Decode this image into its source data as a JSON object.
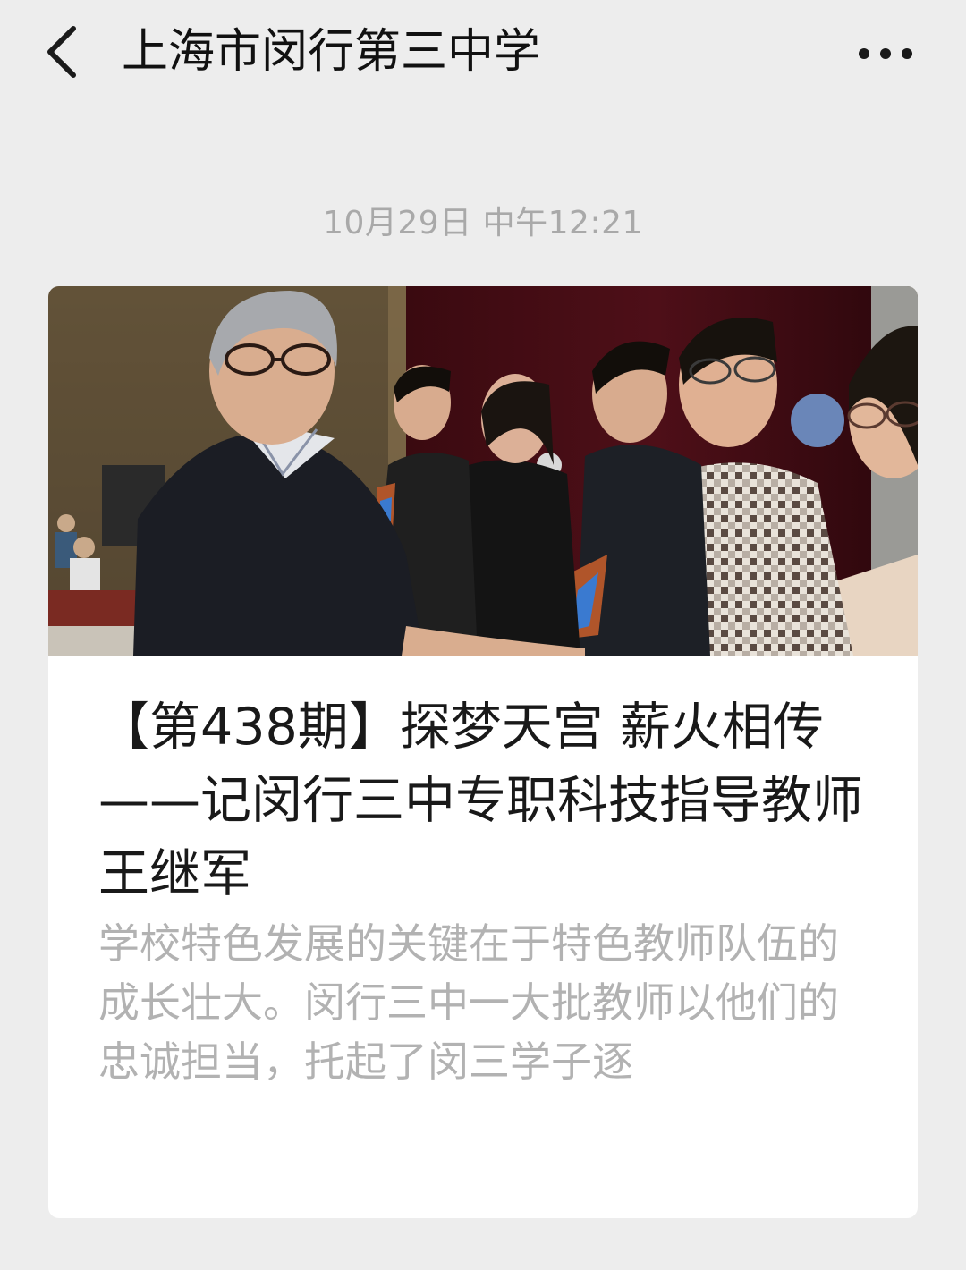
{
  "nav": {
    "back_icon": "chevron-left-icon",
    "title": "上海市闵行第三中学",
    "more_icon": "more-horizontal-icon"
  },
  "message": {
    "timestamp": "10月29日 中午12:21"
  },
  "article": {
    "cover_image": "award-ceremony-photo",
    "title": "【第438期】探梦天宫 薪火相传——记闵行三中专职科技指导教师王继军",
    "summary": "学校特色发展的关键在于特色教师队伍的成长壮大。闵行三中一大批教师以他们的忠诚担当，托起了闵三学子逐"
  },
  "colors": {
    "page_bg": "#ededed",
    "card_bg": "#ffffff",
    "title_text": "#191919",
    "muted_text": "#b2b2b2"
  }
}
